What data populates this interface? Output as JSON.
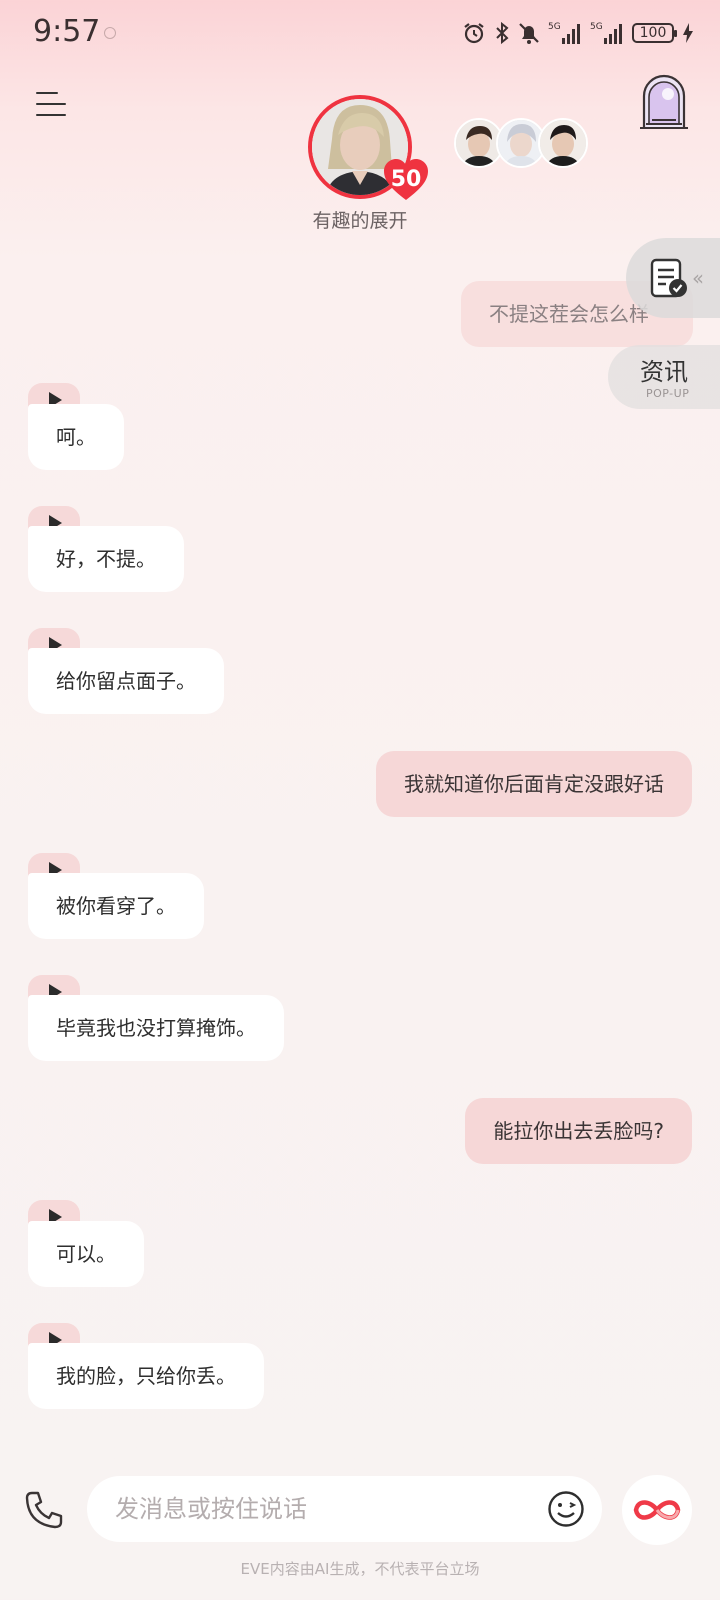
{
  "status_bar": {
    "time": "9:57",
    "battery": "100",
    "network_1": "5G",
    "network_2": "5G"
  },
  "header": {
    "character_name": "有趣的展开",
    "level": "50"
  },
  "side_widgets": {
    "popup_title": "资讯",
    "popup_subtitle": "POP-UP"
  },
  "messages": [
    {
      "role": "user",
      "text": "不提这茬会怎么样"
    },
    {
      "role": "ai",
      "text": "呵。"
    },
    {
      "role": "ai",
      "text": "好，不提。"
    },
    {
      "role": "ai",
      "text": "给你留点面子。"
    },
    {
      "role": "user",
      "text": "我就知道你后面肯定没跟好话"
    },
    {
      "role": "ai",
      "text": "被你看穿了。"
    },
    {
      "role": "ai",
      "text": "毕竟我也没打算掩饰。"
    },
    {
      "role": "user",
      "text": "能拉你出去丢脸吗?"
    },
    {
      "role": "ai",
      "text": "可以。"
    },
    {
      "role": "ai",
      "text": "我的脸，只给你丢。"
    }
  ],
  "input": {
    "placeholder": "发消息或按住说话"
  },
  "footer": {
    "note": "EVE内容由AI生成，不代表平台立场"
  },
  "colors": {
    "accent_red": "#ef3340",
    "user_bubble": "#f6d7d7",
    "ai_bubble": "#ffffff"
  }
}
